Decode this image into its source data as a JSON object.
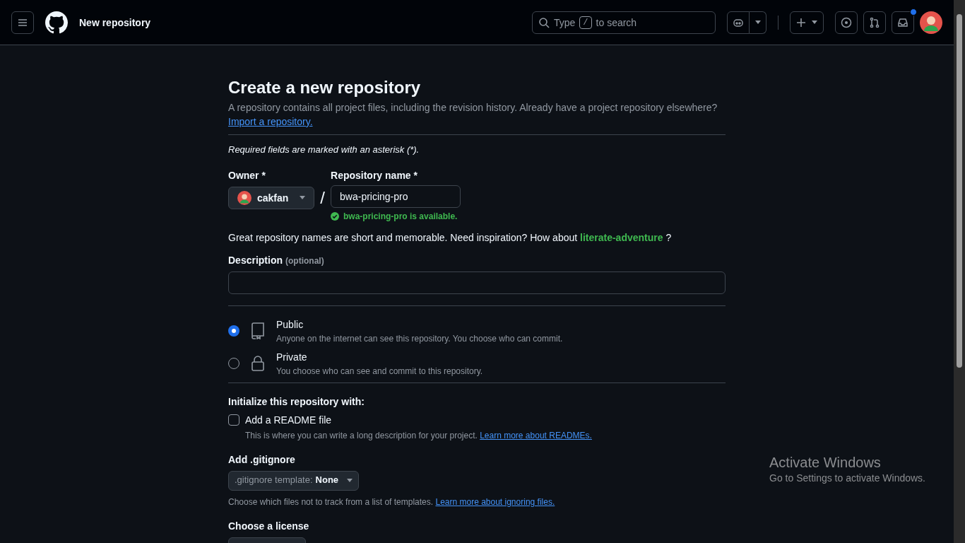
{
  "header": {
    "title": "New repository",
    "search": {
      "before": "Type",
      "key": "/",
      "after": "to search"
    },
    "notifications_unread": true
  },
  "page": {
    "heading": "Create a new repository",
    "intro": "A repository contains all project files, including the revision history. Already have a project repository elsewhere?",
    "import_link": "Import a repository.",
    "required_note": "Required fields are marked with an asterisk (*).",
    "owner": {
      "label": "Owner *",
      "value": "cakfan"
    },
    "separator": "/",
    "repo_name": {
      "label": "Repository name *",
      "value": "bwa-pricing-pro",
      "status": "bwa-pricing-pro is available.",
      "available": true
    },
    "suggestion": {
      "text": "Great repository names are short and memorable. Need inspiration? How about",
      "name": "literate-adventure",
      "end": "?"
    },
    "description": {
      "label": "Description",
      "hint": "(optional)"
    },
    "visibility": [
      {
        "kind": "book",
        "label": "Public",
        "detail": "Anyone on the internet can see this repository. You choose who can commit.",
        "selected": true
      },
      {
        "kind": "lock",
        "label": "Private",
        "detail": "You choose who can see and commit to this repository.",
        "selected": false
      }
    ],
    "initialize": {
      "heading": "Initialize this repository with:",
      "readme": {
        "label": "Add a README file",
        "checked": false,
        "detail": "This is where you can write a long description for your project.",
        "link": "Learn more about READMEs."
      }
    },
    "gitignore": {
      "heading": "Add .gitignore",
      "select_label": ".gitignore template:",
      "select_value": "None",
      "detail": "Choose which files not to track from a list of templates.",
      "link": "Learn more about ignoring files."
    },
    "license": {
      "heading": "Choose a license"
    }
  },
  "overlay": {
    "title": "Activate Windows",
    "subtitle": "Go to Settings to activate Windows."
  }
}
